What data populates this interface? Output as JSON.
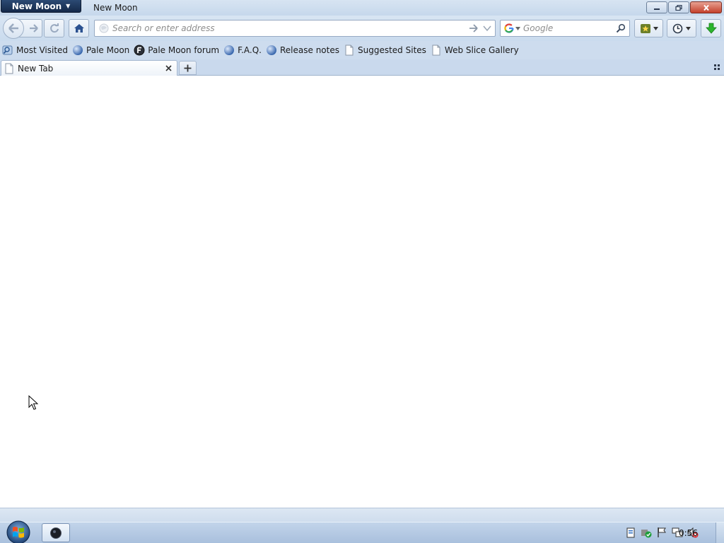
{
  "window": {
    "app_menu_label": "New Moon",
    "title": "New Moon"
  },
  "navbar": {
    "url_placeholder": "Search or enter address",
    "search_placeholder": "Google"
  },
  "bookmarks": [
    {
      "label": "Most Visited",
      "icon": "most-visited-icon"
    },
    {
      "label": "Pale Moon",
      "icon": "globe-icon"
    },
    {
      "label": "Pale Moon forum",
      "icon": "forum-icon"
    },
    {
      "label": "F.A.Q.",
      "icon": "globe-icon"
    },
    {
      "label": "Release notes",
      "icon": "globe-icon"
    },
    {
      "label": "Suggested Sites",
      "icon": "page-icon"
    },
    {
      "label": "Web Slice Gallery",
      "icon": "page-icon"
    }
  ],
  "tabs": [
    {
      "label": "New Tab",
      "active": true
    }
  ],
  "taskbar": {
    "clock": "0:56"
  },
  "colors": {
    "chrome": "#cddcee",
    "app_menu": "#1d3558",
    "close_button": "#c4412c",
    "download_arrow": "#2db52d"
  }
}
